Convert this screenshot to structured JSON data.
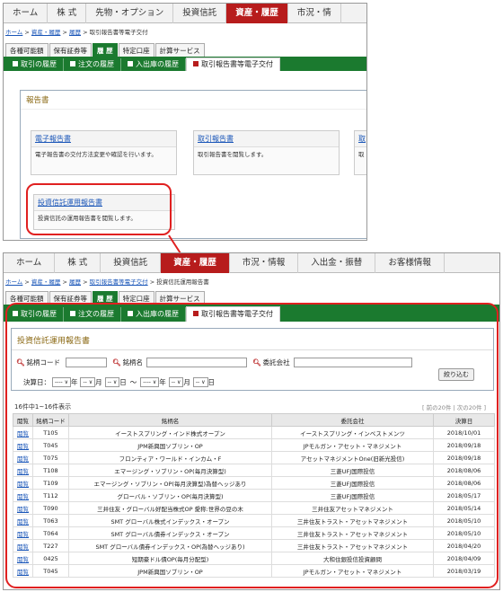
{
  "top": {
    "gnav": [
      "ホーム",
      "株 式",
      "先物・オプション",
      "投資信託",
      "資産・履歴",
      "市況・情"
    ],
    "gnav_active": 4,
    "breadcrumb": [
      "ホーム",
      ">",
      "資産・履歴",
      ">",
      "履歴",
      ">",
      "取引報告書等電子交付"
    ],
    "subtabs": [
      "各種可能額",
      "保有証券等",
      "履 歴",
      "特定口座",
      "計算サービス"
    ],
    "subtabs_active": 2,
    "greentabs": [
      "取引の履歴",
      "注文の履歴",
      "入出庫の履歴",
      "取引報告書等電子交付"
    ],
    "greentabs_active": 3,
    "section_title": "報告書",
    "cards": [
      {
        "title": "電子報告書",
        "desc": "電子報告書の交付方法変更や確認を行います。"
      },
      {
        "title": "取引報告書",
        "desc": "取引報告書を閲覧します。"
      },
      {
        "title": "取",
        "desc": "取"
      },
      {
        "title": "投資信託運用報告書",
        "desc": "投資信託の運用報告書を閲覧します。"
      }
    ]
  },
  "bottom": {
    "gnav": [
      "ホーム",
      "株 式",
      "投資信託",
      "資産・履歴",
      "市況・情報",
      "入出金・振替",
      "お客様情報"
    ],
    "gnav_active": 3,
    "breadcrumb": [
      "ホーム",
      ">",
      "資産・履歴",
      ">",
      "履歴",
      ">",
      "取引報告書等電子交付",
      ">",
      "投資信託運用報告書"
    ],
    "subtabs": [
      "各種可能額",
      "保有証券等",
      "履 歴",
      "特定口座",
      "計算サービス"
    ],
    "subtabs_active": 2,
    "greentabs": [
      "取引の履歴",
      "注文の履歴",
      "入出庫の履歴",
      "取引報告書等電子交付"
    ],
    "greentabs_active": 3,
    "panel_title": "投資信託運用報告書",
    "search": {
      "code_label": "銘柄コード",
      "name_label": "銘柄名",
      "company_label": "委託会社",
      "date_label": "決算日：",
      "year_sel": "---- ∨",
      "month_sel": "-- ∨",
      "day_sel": "-- ∨",
      "year_unit": "年",
      "month_unit": "月",
      "day_unit": "日",
      "tilde": "〜",
      "filter_button": "絞り込む"
    },
    "count_text": "16件中1~16件表示",
    "pager": "[ 前の20件 | 次の20件 ]",
    "columns": [
      "閲覧",
      "銘柄コード",
      "銘柄名",
      "委託会社",
      "決算日"
    ],
    "rows": [
      [
        "閲覧",
        "T105",
        "イーストスプリング・インド株式オープン",
        "イーストスプリング・インベストメンツ",
        "2018/10/01"
      ],
      [
        "閲覧",
        "T045",
        "JPM新興国ソブリン・OP",
        "JPモルガン・アセット・マネジメント",
        "2018/09/18"
      ],
      [
        "閲覧",
        "T075",
        "フロンティア・ワールド・インカム・F",
        "アセットマネジメントOne(旧新光投信)",
        "2018/09/18"
      ],
      [
        "閲覧",
        "T108",
        "エマージング・ソブリン・OP(毎月決算型)",
        "三菱UFJ国際投信",
        "2018/08/06"
      ],
      [
        "閲覧",
        "T109",
        "エマージング・ソブリン・OP(毎月決算型)為替ヘッジあり",
        "三菱UFJ国際投信",
        "2018/08/06"
      ],
      [
        "閲覧",
        "T112",
        "グローバル・ソブリン・OP(毎月決算型)",
        "三菱UFJ国際投信",
        "2018/05/17"
      ],
      [
        "閲覧",
        "T090",
        "三井住友・グローバル好配当株式OP 愛称:世界の豆の木",
        "三井住友アセットマネジメント",
        "2018/05/14"
      ],
      [
        "閲覧",
        "T063",
        "SMT グローバル株式インデックス・オープン",
        "三井住友トラスト・アセットマネジメント",
        "2018/05/10"
      ],
      [
        "閲覧",
        "T064",
        "SMT グローバル債券インデックス・オープン",
        "三井住友トラスト・アセットマネジメント",
        "2018/05/10"
      ],
      [
        "閲覧",
        "T227",
        "SMT グローバル債券インデックス・OP(為替ヘッジあり)",
        "三井住友トラスト・アセットマネジメント",
        "2018/04/20"
      ],
      [
        "閲覧",
        "0425",
        "短期豪ドル債OP(毎月分配型)",
        "大和住銀投信投資顧問",
        "2018/04/09"
      ],
      [
        "閲覧",
        "T045",
        "JPM新興国ソブリン・OP",
        "JPモルガン・アセット・マネジメント",
        "2018/03/19"
      ]
    ]
  },
  "colors": {
    "brand_red": "#b71c1c",
    "green": "#1b7a2f",
    "highlight": "#e02020",
    "link": "#1a56b8"
  }
}
